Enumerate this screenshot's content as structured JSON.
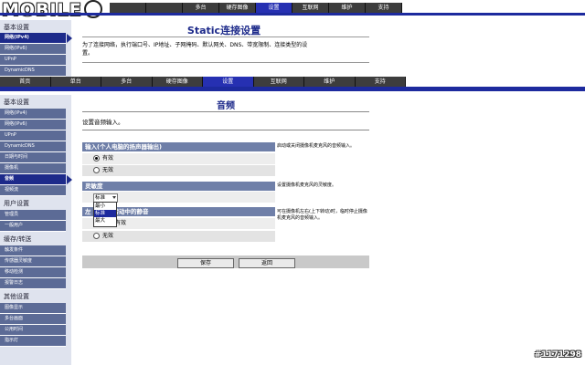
{
  "logo": {
    "text": "MOBILE"
  },
  "top_nav": [
    "",
    "",
    "多台",
    "硬存图像",
    "设置",
    "互联网",
    "维护",
    "支持"
  ],
  "top_sidebar": {
    "group": "基本设置",
    "items": [
      "网络(IPv4)",
      "网络(IPv6)",
      "UPnP",
      "DynamicDNS"
    ]
  },
  "top_content": {
    "title": "Static连接设置",
    "desc_line1": "为了连接网络，执行端口号、IP地址、子网掩码、默认网关、DNS、带宽限制、连接类型的设",
    "desc_line2": "置。"
  },
  "main_nav": [
    "首页",
    "单台",
    "多台",
    "硬存图像",
    "设置",
    "互联网",
    "维护",
    "支持"
  ],
  "sidebar": {
    "groups": [
      {
        "label": "基本设置",
        "items": [
          "网络(IPv4)",
          "网络(IPv6)",
          "UPnP",
          "DynamicDNS",
          "日期与时间",
          "摄像机",
          "音频",
          "视频流"
        ]
      },
      {
        "label": "用户设置",
        "items": [
          "管理员",
          "一般用户"
        ]
      },
      {
        "label": "缓存/转送",
        "items": [
          "触发条件",
          "传感器灵敏度",
          "移动检测",
          "报警日志"
        ]
      },
      {
        "label": "其他设置",
        "items": [
          "图像显示",
          "多台画面",
          "公用时间",
          "指示灯"
        ]
      }
    ]
  },
  "content": {
    "title": "音频",
    "desc": "设置音频输入。",
    "section1": {
      "header": "输入(个人电脑的扬声器输出)",
      "opt_on": "有效",
      "opt_off": "无效",
      "help": "启动或关闭摄像机麦克风的音频输入。"
    },
    "section2": {
      "header": "灵敏度",
      "selected": "标准",
      "options": [
        "最小",
        "标准",
        "最大"
      ],
      "help": "设置摄像机麦克风的灵敏度。"
    },
    "section3": {
      "header_left": "左",
      "header_right": "转动中的静音",
      "opt_on_partial": "有效",
      "opt_off": "无效",
      "help": "可在摄像机左右(上下转动)时，临时停止摄像机麦克风的音频输入。"
    },
    "buttons": {
      "save": "保存",
      "back": "返回"
    }
  },
  "watermark": "#1171298",
  "colors": {
    "nav_bg": "#3d3d3d",
    "nav_active": "#2630b2",
    "sidebar_item": "#5c6b96",
    "section_header": "#6f7fa8"
  }
}
